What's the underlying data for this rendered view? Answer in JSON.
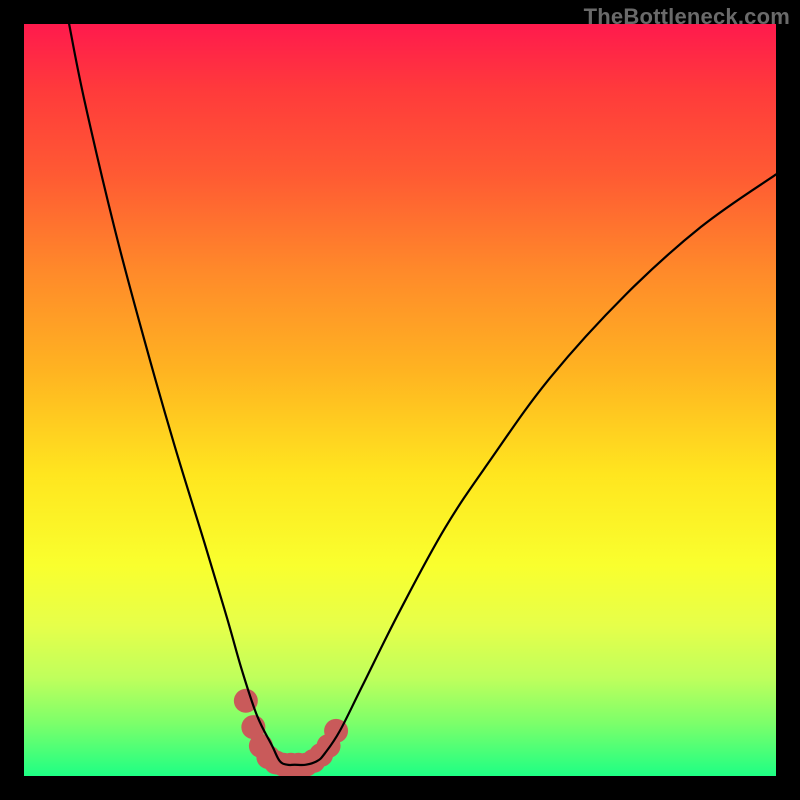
{
  "watermark": "TheBottleneck.com",
  "chart_data": {
    "type": "line",
    "title": "",
    "xlabel": "",
    "ylabel": "",
    "xlim": [
      0,
      100
    ],
    "ylim": [
      0,
      100
    ],
    "series": [
      {
        "name": "curve",
        "x": [
          6,
          8,
          12,
          16,
          20,
          24,
          27,
          29,
          31,
          33,
          34,
          35,
          36,
          37.5,
          39,
          40,
          42,
          45,
          50,
          56,
          62,
          70,
          80,
          90,
          100
        ],
        "values": [
          100,
          90,
          73,
          58,
          44,
          31,
          21,
          14,
          8,
          4,
          2,
          1.5,
          1.5,
          1.5,
          2,
          3,
          6,
          12,
          22,
          33,
          42,
          53,
          64,
          73,
          80
        ]
      }
    ],
    "markers": {
      "name": "highlight-band",
      "color": "#c95a5a",
      "points_xy": [
        [
          30.5,
          6.5
        ],
        [
          31.5,
          4.0
        ],
        [
          32.5,
          2.5
        ],
        [
          33.5,
          1.8
        ],
        [
          34.5,
          1.5
        ],
        [
          35.5,
          1.5
        ],
        [
          36.5,
          1.5
        ],
        [
          37.5,
          1.5
        ],
        [
          38.5,
          2.0
        ],
        [
          39.5,
          2.8
        ],
        [
          40.5,
          4.0
        ],
        [
          41.5,
          6.0
        ]
      ],
      "lone_point_xy": [
        29.5,
        10.0
      ],
      "radius_px": 12
    }
  }
}
